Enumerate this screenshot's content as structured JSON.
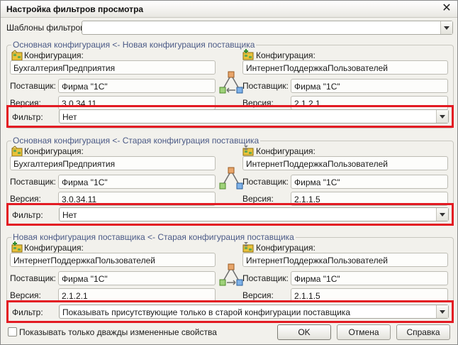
{
  "window": {
    "title": "Настройка фильтров просмотра"
  },
  "templates": {
    "label": "Шаблоны фильтров:",
    "value": ""
  },
  "groups": [
    {
      "title": "Основная конфигурация <- Новая конфигурация поставщика",
      "left": {
        "config_label": "Конфигурация:",
        "config_value": "БухгалтерияПредприятия",
        "supplier_label": "Поставщик:",
        "supplier_value": "Фирма \"1С\"",
        "version_label": "Версия:",
        "version_value": "3.0.34.11"
      },
      "right": {
        "config_label": "Конфигурация:",
        "config_value": "ИнтернетПоддержкаПользователей",
        "supplier_label": "Поставщик:",
        "supplier_value": "Фирма \"1С\"",
        "version_label": "Версия:",
        "version_value": "2.1.2.1"
      },
      "filter_label": "Фильтр:",
      "filter_value": "Нет"
    },
    {
      "title": "Основная конфигурация <- Старая конфигурация поставщика",
      "left": {
        "config_label": "Конфигурация:",
        "config_value": "БухгалтерияПредприятия",
        "supplier_label": "Поставщик:",
        "supplier_value": "Фирма \"1С\"",
        "version_label": "Версия:",
        "version_value": "3.0.34.11"
      },
      "right": {
        "config_label": "Конфигурация:",
        "config_value": "ИнтернетПоддержкаПользователей",
        "supplier_label": "Поставщик:",
        "supplier_value": "Фирма \"1С\"",
        "version_label": "Версия:",
        "version_value": "2.1.1.5"
      },
      "filter_label": "Фильтр:",
      "filter_value": "Нет"
    },
    {
      "title": "Новая конфигурация поставщика <- Старая конфигурация поставщика",
      "left": {
        "config_label": "Конфигурация:",
        "config_value": "ИнтернетПоддержкаПользователей",
        "supplier_label": "Поставщик:",
        "supplier_value": "Фирма \"1С\"",
        "version_label": "Версия:",
        "version_value": "2.1.2.1"
      },
      "right": {
        "config_label": "Конфигурация:",
        "config_value": "ИнтернетПоддержкаПользователей",
        "supplier_label": "Поставщик:",
        "supplier_value": "Фирма \"1С\"",
        "version_label": "Версия:",
        "version_value": "2.1.1.5"
      },
      "filter_label": "Фильтр:",
      "filter_value": "Показывать присутствующие только в старой конфигурации поставщика"
    }
  ],
  "options": {
    "double_changed_label": "Показывать только дважды измененные свойства",
    "double_changed_checked": false
  },
  "buttons": {
    "ok": "OK",
    "cancel": "Отмена",
    "help": "Справка"
  },
  "colors": {
    "highlight": "#e31b23",
    "group_title": "#4b5a86"
  }
}
